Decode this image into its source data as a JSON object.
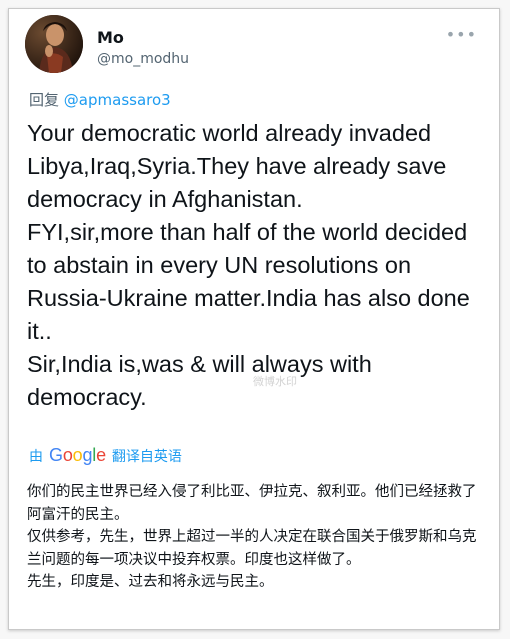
{
  "author": {
    "name": "Mo",
    "handle": "@mo_modhu",
    "avatar_icon": "portrait-painting-avatar"
  },
  "more_icon": "more-horizontal-icon",
  "reply": {
    "prefix": "回复",
    "mention": "@apmassaro3"
  },
  "tweet": {
    "paragraphs": [
      "Your democratic world already invaded Libya,Iraq,Syria.They have already save democracy in Afghanistan.",
      "FYI,sir,more than half of the world decided to abstain in every UN resolutions on Russia-Ukraine matter.India has also done it..",
      "Sir,India is,was & will always with democracy."
    ]
  },
  "watermark": "微博水印",
  "translation": {
    "by": "由",
    "google": [
      "G",
      "o",
      "o",
      "g",
      "l",
      "e"
    ],
    "google_colors": [
      "#4285f4",
      "#ea4335",
      "#fbbc05",
      "#4285f4",
      "#34a853",
      "#ea4335"
    ],
    "label": "翻译自英语",
    "paragraphs": [
      "你们的民主世界已经入侵了利比亚、伊拉克、叙利亚。他们已经拯救了阿富汗的民主。",
      "仅供参考，先生，世界上超过一半的人决定在联合国关于俄罗斯和乌克兰问题的每一项决议中投弃权票。印度也这样做了。",
      "先生，印度是、过去和将永远与民主。"
    ]
  },
  "colors": {
    "link": "#1d9bf0",
    "secondary_text": "#536471",
    "primary_text": "#0f1419"
  }
}
